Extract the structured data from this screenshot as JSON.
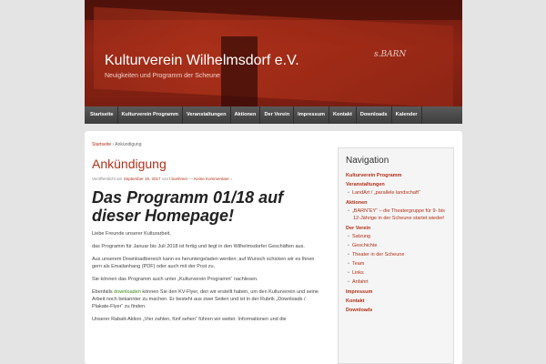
{
  "header": {
    "site_title": "Kulturverein Wilhelmsdorf e.V.",
    "site_description": "Neuigkeiten und Programm der Scheune",
    "sign_text": "s.BARN"
  },
  "nav": {
    "items": [
      "Startseite",
      "Kulturverein Programm",
      "Veranstaltungen",
      "Aktionen",
      "Der Verein",
      "Impressum",
      "Kontakt",
      "Downloads",
      "Kalender"
    ]
  },
  "content": {
    "breadcrumb_home": "Startseite",
    "breadcrumb_sep": " › ",
    "breadcrumb_current": "Ankündigung",
    "title": "Ankündigung",
    "meta_prefix": "Veröffentlicht am ",
    "meta_date": "September 15, 2017",
    "meta_by": " von ",
    "meta_author": "l.boehmer",
    "meta_dash": " — ",
    "meta_comments": "Keine Kommentare ↓",
    "post_heading": "Das Programm 01/18 auf dieser Homepage!",
    "paragraphs": [
      "Liebe Freunde unserer Kulturarbeit,",
      "das Programm für Januar bis Juli 2018 ist fertig und liegt in den Wilhelmsdorfer Geschäften aus.",
      "Aus unserem Downloadbereich kann es heruntergeladen werden; auf Wunsch schicken wir es Ihnen gern als Emailanhang (PDF) oder auch mit der Post zu.",
      "Sie können das Programm auch unter „Kulturverein Programm“ nachlesen."
    ],
    "para5_before": "Ebenfalls ",
    "para5_link": "downloaden",
    "para5_after": " können Sie den KV-Flyer, den wir erstellt haben, um den Kulturverein und seine Arbeit noch bekannter zu machen. Er besteht aus zwei Seiten und ist in der Rubrik „Downloads / Plakate-Flyer“ zu finden.",
    "para6": "Unserer Rabatt-Aktion „Vier zahlen, fünf sehen“ führen wir weiter. Informationen und die"
  },
  "sidebar": {
    "title": "Navigation",
    "cat_programm": "Kulturverein Programm",
    "cat_veranstaltungen": "Veranstaltungen",
    "sub_landart": "LandArt / „parallele landschaft“",
    "cat_aktionen": "Aktionen",
    "sub_barney": "„BARN“EY“ – die Theatergruppe für 9- bis 12-Jährige in der Scheune startet wieder!",
    "cat_verein": "Der Verein",
    "verein_subs": [
      "Satzung",
      "Geschichte",
      "Theater in der Scheune",
      "Team",
      "Links",
      "Anfahrt"
    ],
    "cat_impressum": "Impressum",
    "cat_kontakt": "Kontakt",
    "cat_downloads": "Downloads"
  }
}
